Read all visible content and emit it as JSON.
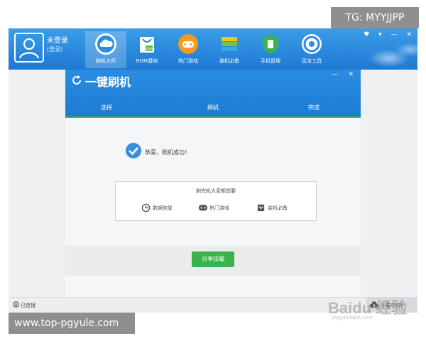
{
  "watermarks": {
    "top": "TG: MYYJJPP",
    "bottom": "www.top-pgyule.com",
    "baidu": "Baidu 经验",
    "baidu_sub": "jingyan.baidu.com"
  },
  "user": {
    "name": "未登录",
    "sub": "(登录)"
  },
  "nav": [
    {
      "label": "刷机大师",
      "icon": "cloud-icon"
    },
    {
      "label": "ROM基地",
      "icon": "rom-bag-icon"
    },
    {
      "label": "热门游戏",
      "icon": "gamepad-icon"
    },
    {
      "label": "装机必备",
      "icon": "app-stack-icon"
    },
    {
      "label": "手机管理",
      "icon": "shield-icon"
    },
    {
      "label": "百宝工具",
      "icon": "refresh-tool-icon"
    }
  ],
  "window_controls": [
    "♥",
    "▾",
    "—",
    "✕"
  ],
  "dialog": {
    "title": "一键刷机",
    "controls": [
      "—",
      "✕"
    ],
    "steps": [
      "选择",
      "刷机",
      "完成"
    ],
    "success": "恭喜，刷机成功！",
    "recommend_title": "刷完机大家都想要",
    "recommend": [
      {
        "label": "数据恢复",
        "icon": "data-restore-icon"
      },
      {
        "label": "热门游戏",
        "icon": "gamepad-icon"
      },
      {
        "label": "装机必备",
        "icon": "package-icon"
      }
    ],
    "share_button": "分享炫耀"
  },
  "status": {
    "connection": "已连接",
    "download": "下载中(0)"
  },
  "colors": {
    "primary": "#1e79d4",
    "success": "#35c23a",
    "button": "#3ab44a"
  }
}
